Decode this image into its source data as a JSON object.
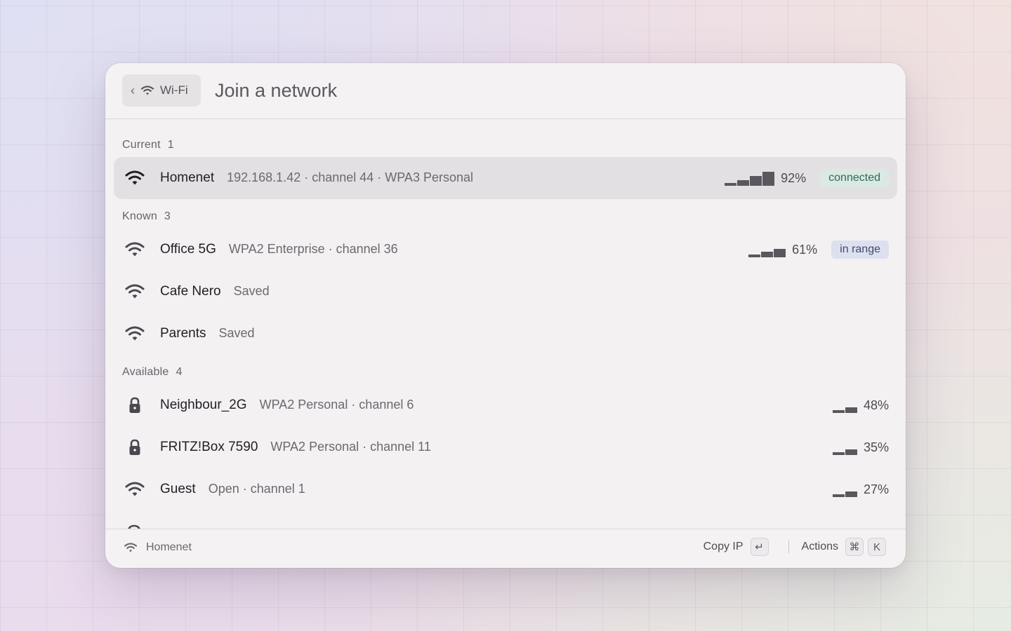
{
  "header": {
    "back_label": "Wi-Fi",
    "title": "Join a network"
  },
  "sections": {
    "current": {
      "label": "Current",
      "count": "1"
    },
    "known": {
      "label": "Known",
      "count": "3"
    },
    "available": {
      "label": "Available",
      "count": "4"
    }
  },
  "networks": {
    "homenet": {
      "name": "Homenet",
      "sub": "192.168.1.42 · channel 44 · WPA3 Personal",
      "signal": "92%",
      "signal_value": 92,
      "badge": "connected",
      "icon": "wifi-icon"
    },
    "office": {
      "name": "Office 5G",
      "sub": "WPA2 Enterprise · channel 36",
      "signal": "61%",
      "signal_value": 61,
      "badge": "in range",
      "icon": "wifi-icon"
    },
    "cafe": {
      "name": "Cafe Nero",
      "sub": "Saved",
      "icon": "wifi-icon"
    },
    "parents": {
      "name": "Parents",
      "sub": "Saved",
      "icon": "wifi-icon"
    },
    "neighbour": {
      "name": "Neighbour_2G",
      "sub": "WPA2 Personal · channel 6",
      "signal": "48%",
      "signal_value": 48,
      "icon": "lock-icon"
    },
    "fritz": {
      "name": "FRITZ!Box 7590",
      "sub": "WPA2 Personal · channel 11",
      "signal": "35%",
      "signal_value": 35,
      "icon": "lock-icon"
    },
    "guest": {
      "name": "Guest",
      "sub": "Open · channel 1",
      "signal": "27%",
      "signal_value": 27,
      "icon": "wifi-icon"
    }
  },
  "footer": {
    "current_network": "Homenet",
    "copy_label": "Copy IP",
    "copy_key": "↵",
    "actions_label": "Actions",
    "actions_key_1": "⌘",
    "actions_key_2": "K"
  },
  "colors": {
    "connected_badge_bg": "#dbe9e3",
    "connected_badge_text": "#2f6a57",
    "inrange_badge_bg": "#dde0ee",
    "inrange_badge_text": "#3f4a72"
  }
}
